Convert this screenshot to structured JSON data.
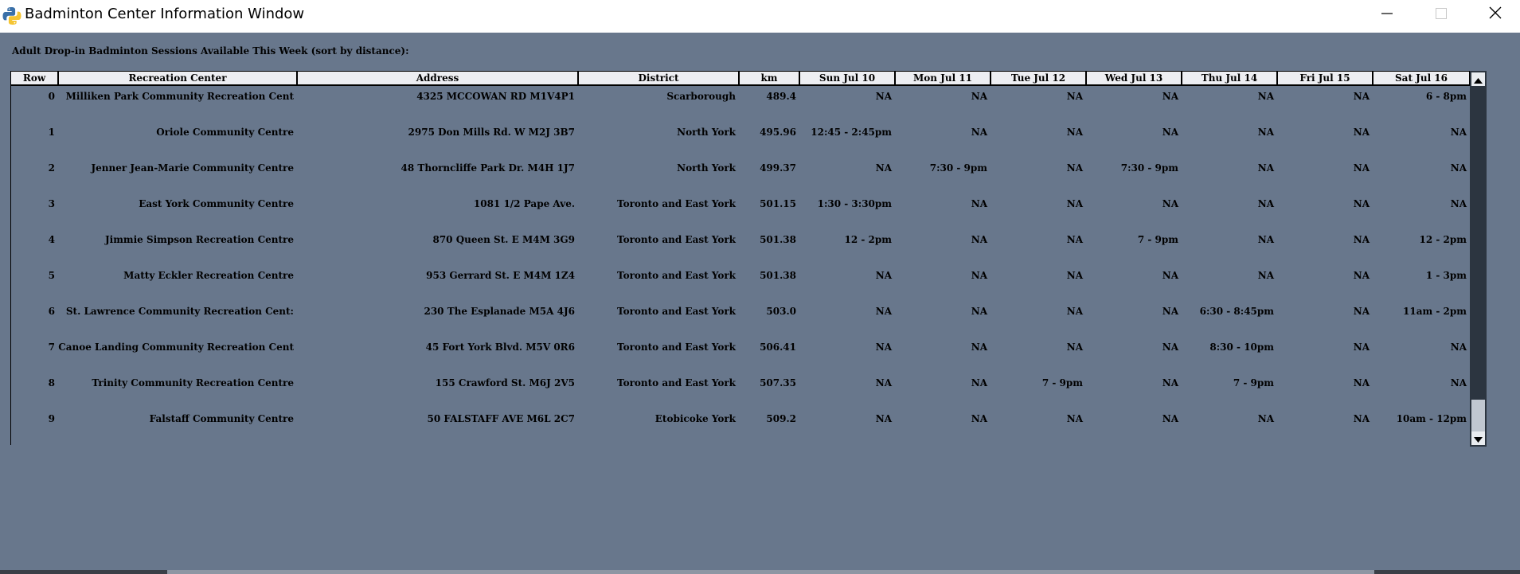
{
  "window": {
    "title": "Badminton Center Information Window"
  },
  "heading": "Adult Drop-in Badminton Sessions Available This Week (sort by distance):",
  "columns": [
    "Row",
    "Recreation Center",
    "Address",
    "District",
    "km",
    "Sun Jul 10",
    "Mon Jul 11",
    "Tue Jul 12",
    "Wed Jul 13",
    "Thu Jul 14",
    "Fri Jul 15",
    "Sat Jul 16"
  ],
  "rows": [
    [
      "0",
      "Milliken Park Community Recreation Cent",
      "4325 MCCOWAN RD M1V4P1",
      "Scarborough",
      "489.4",
      "NA",
      "NA",
      "NA",
      "NA",
      "NA",
      "NA",
      "6 - 8pm"
    ],
    [
      "1",
      "Oriole Community Centre",
      "2975 Don Mills Rd. W M2J 3B7",
      "North York",
      "495.96",
      "12:45 - 2:45pm",
      "NA",
      "NA",
      "NA",
      "NA",
      "NA",
      "NA"
    ],
    [
      "2",
      "Jenner Jean-Marie Community Centre",
      "48 Thorncliffe Park Dr. M4H 1J7",
      "North York",
      "499.37",
      "NA",
      "7:30 - 9pm",
      "NA",
      "7:30 - 9pm",
      "NA",
      "NA",
      "NA"
    ],
    [
      "3",
      "East York Community Centre",
      "1081 1/2 Pape Ave.",
      "Toronto and East York",
      "501.15",
      "1:30 - 3:30pm",
      "NA",
      "NA",
      "NA",
      "NA",
      "NA",
      "NA"
    ],
    [
      "4",
      "Jimmie Simpson Recreation Centre",
      "870 Queen St. E M4M 3G9",
      "Toronto and East York",
      "501.38",
      "12 - 2pm",
      "NA",
      "NA",
      "7 - 9pm",
      "NA",
      "NA",
      "12 - 2pm"
    ],
    [
      "5",
      "Matty Eckler Recreation Centre",
      "953 Gerrard St. E M4M 1Z4",
      "Toronto and East York",
      "501.38",
      "NA",
      "NA",
      "NA",
      "NA",
      "NA",
      "NA",
      "1 - 3pm"
    ],
    [
      "6",
      "St. Lawrence Community Recreation Cent:",
      "230 The Esplanade M5A 4J6",
      "Toronto and East York",
      "503.0",
      "NA",
      "NA",
      "NA",
      "NA",
      "6:30 - 8:45pm",
      "NA",
      "11am - 2pm"
    ],
    [
      "7",
      "Canoe Landing Community Recreation Cent",
      "45 Fort York Blvd. M5V 0R6",
      "Toronto and East York",
      "506.41",
      "NA",
      "NA",
      "NA",
      "NA",
      "8:30 - 10pm",
      "NA",
      "NA"
    ],
    [
      "8",
      "Trinity Community Recreation Centre",
      "155 Crawford St. M6J 2V5",
      "Toronto and East York",
      "507.35",
      "NA",
      "NA",
      "7 - 9pm",
      "NA",
      "7 - 9pm",
      "NA",
      "NA"
    ],
    [
      "9",
      "Falstaff Community Centre",
      "50 FALSTAFF AVE M6L 2C7",
      "Etobicoke York",
      "509.2",
      "NA",
      "NA",
      "NA",
      "NA",
      "NA",
      "NA",
      "10am - 12pm"
    ]
  ],
  "colors": {
    "window_bg": "#68778c",
    "header_bg": "#edeef2",
    "text": "#000000"
  },
  "icons": {
    "app": "python-icon",
    "minimize": "minimize-icon",
    "maximize": "maximize-icon",
    "close": "close-icon",
    "scroll_up": "scroll-up-arrow-icon",
    "scroll_down": "scroll-down-arrow-icon"
  }
}
